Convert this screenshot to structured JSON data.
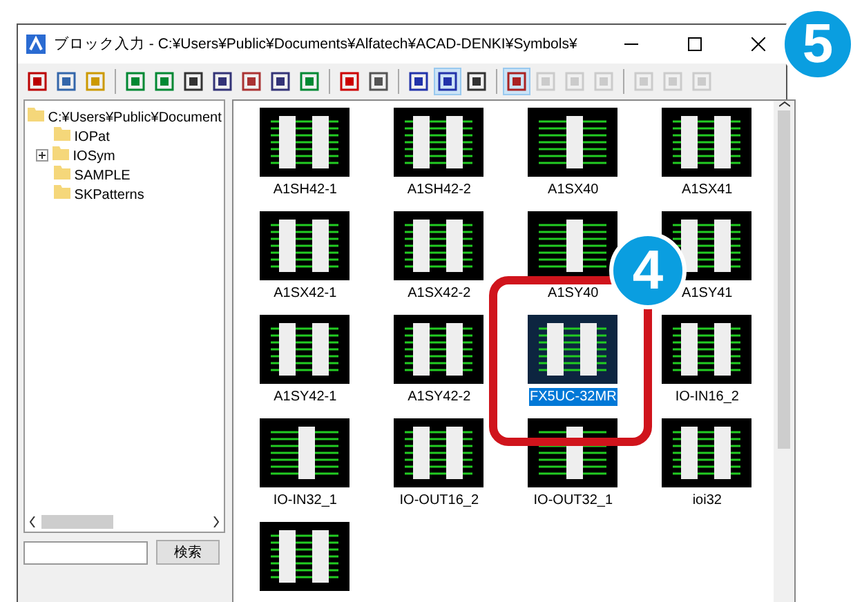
{
  "window": {
    "title": "ブロック入力 - C:¥Users¥Public¥Documents¥Alfatech¥ACAD-DENKI¥Symbols¥"
  },
  "toolbar": {
    "groups": [
      [
        {
          "pressed": false,
          "disabled": false
        },
        {
          "pressed": false,
          "disabled": false
        },
        {
          "pressed": false,
          "disabled": false
        }
      ],
      [
        {
          "pressed": false,
          "disabled": false
        },
        {
          "pressed": false,
          "disabled": false
        },
        {
          "pressed": false,
          "disabled": false
        },
        {
          "pressed": false,
          "disabled": false
        },
        {
          "pressed": false,
          "disabled": false
        },
        {
          "pressed": false,
          "disabled": false
        },
        {
          "pressed": false,
          "disabled": false
        }
      ],
      [
        {
          "pressed": false,
          "disabled": false
        },
        {
          "pressed": false,
          "disabled": false
        }
      ],
      [
        {
          "pressed": false,
          "disabled": false
        },
        {
          "pressed": true,
          "disabled": false
        },
        {
          "pressed": false,
          "disabled": false
        }
      ],
      [
        {
          "pressed": true,
          "disabled": false
        },
        {
          "pressed": false,
          "disabled": true
        },
        {
          "pressed": false,
          "disabled": true
        },
        {
          "pressed": false,
          "disabled": true
        }
      ],
      [
        {
          "pressed": false,
          "disabled": true
        },
        {
          "pressed": false,
          "disabled": true
        },
        {
          "pressed": false,
          "disabled": true
        }
      ]
    ]
  },
  "tree": {
    "label": "C:¥Users¥Public¥Document",
    "children": [
      {
        "label": "IOPat",
        "has_children": false
      },
      {
        "label": "IOSym",
        "has_children": true
      },
      {
        "label": "SAMPLE",
        "has_children": false
      },
      {
        "label": "SKPatterns",
        "has_children": false
      }
    ]
  },
  "search": {
    "button": "検索"
  },
  "blocks": [
    {
      "name": "A1SH42-1",
      "kind": "double",
      "selected": false
    },
    {
      "name": "A1SH42-2",
      "kind": "double",
      "selected": false
    },
    {
      "name": "A1SX40",
      "kind": "single",
      "selected": false
    },
    {
      "name": "A1SX41",
      "kind": "double",
      "selected": false
    },
    {
      "name": "A1SX42-1",
      "kind": "double",
      "selected": false
    },
    {
      "name": "A1SX42-2",
      "kind": "double",
      "selected": false
    },
    {
      "name": "A1SY40",
      "kind": "single",
      "selected": false
    },
    {
      "name": "A1SY41",
      "kind": "double",
      "selected": false
    },
    {
      "name": "A1SY42-1",
      "kind": "double",
      "selected": false
    },
    {
      "name": "A1SY42-2",
      "kind": "double",
      "selected": false
    },
    {
      "name": "FX5UC-32MR",
      "kind": "double",
      "selected": true
    },
    {
      "name": "IO-IN16_2",
      "kind": "double",
      "selected": false
    },
    {
      "name": "IO-IN32_1",
      "kind": "single",
      "selected": false
    },
    {
      "name": "IO-OUT16_2",
      "kind": "double",
      "selected": false
    },
    {
      "name": "IO-OUT32_1",
      "kind": "single",
      "selected": false
    },
    {
      "name": "ioi32",
      "kind": "double",
      "selected": false
    },
    {
      "kind": "double",
      "selected": false
    }
  ],
  "callouts": [
    {
      "number": "5"
    },
    {
      "number": "4"
    }
  ]
}
